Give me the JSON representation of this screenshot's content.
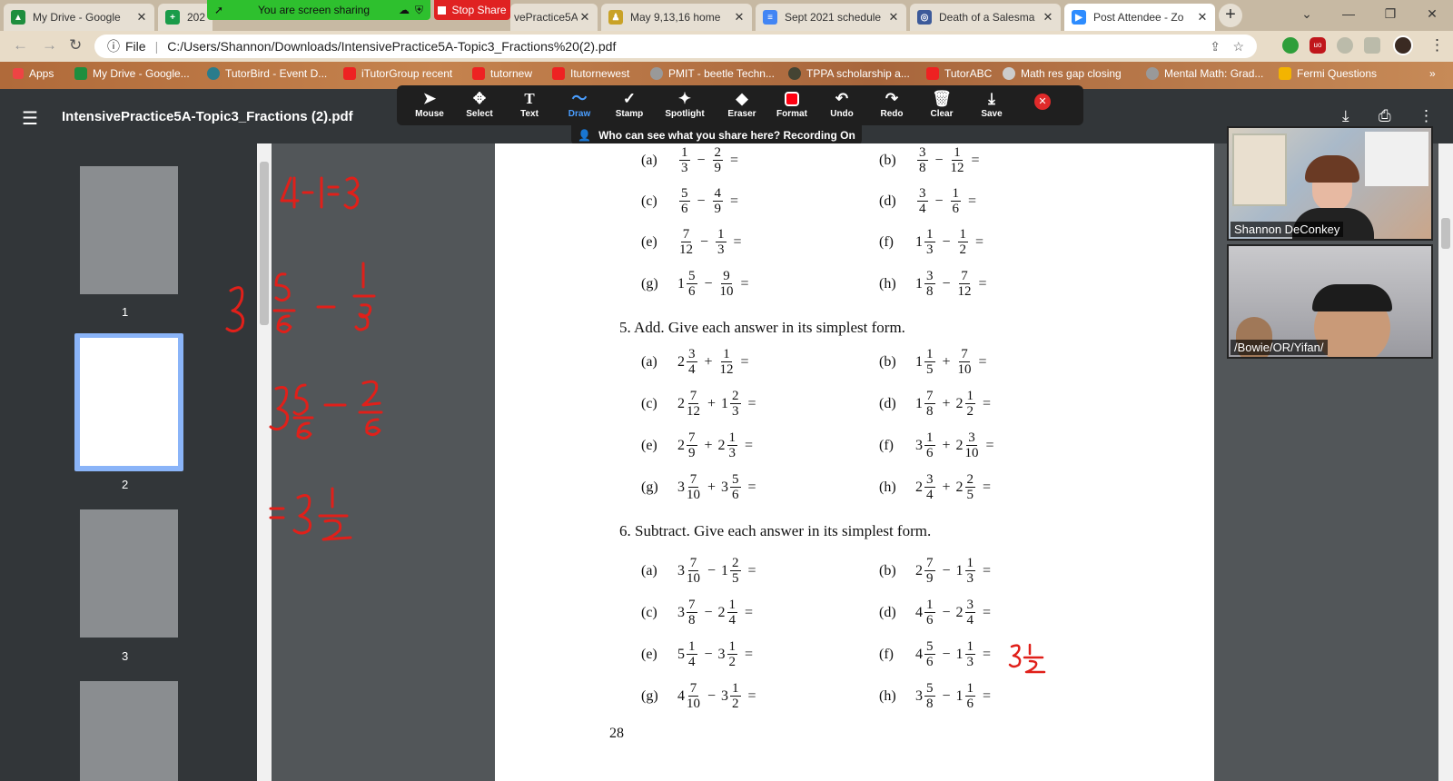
{
  "tabs": [
    {
      "title": "My Drive - Google",
      "color": "#1e8e3e",
      "glyph": "▲"
    },
    {
      "title": "202",
      "color": "#1a9c4a",
      "glyph": "+"
    },
    {
      "title": "vePractice5A",
      "color": "#666",
      "glyph": ""
    },
    {
      "title": "May 9,13,16 home",
      "color": "#c9a227",
      "glyph": "♟"
    },
    {
      "title": "Sept 2021 schedule",
      "color": "#4285f4",
      "glyph": "≡"
    },
    {
      "title": "Death of a Salesma",
      "color": "#3c5a9a",
      "glyph": "◎"
    },
    {
      "title": "Post Attendee - Zo",
      "color": "#2d8cff",
      "glyph": "▶"
    }
  ],
  "screen_share": {
    "message": "You are screen sharing",
    "stop_label": "Stop Share"
  },
  "address": {
    "prefix": "File",
    "url": "C:/Users/Shannon/Downloads/IntensivePractice5A-Topic3_Fractions%20(2).pdf"
  },
  "bookmarks": [
    "Apps",
    "My Drive - Google...",
    "TutorBird - Event D...",
    "iTutorGroup recent",
    "tutornew",
    "Itutornewest",
    "PMIT - beetle Techn...",
    "TPPA scholarship a...",
    "TutorABC",
    "Math res gap closing",
    "Mental Math: Grad...",
    "Fermi Questions"
  ],
  "pdf": {
    "title": "IntensivePractice5A-Topic3_Fractions (2).pdf",
    "page_number": "28"
  },
  "annotate_tools": [
    "Mouse",
    "Select",
    "Text",
    "Draw",
    "Stamp",
    "Spotlight",
    "Eraser",
    "Format",
    "Undo",
    "Redo",
    "Clear",
    "Save"
  ],
  "recording_notice": "Who can see what you share here? Recording On",
  "thumbnails": [
    "1",
    "2",
    "3"
  ],
  "sections": [
    {
      "heading": "5. Add. Give each answer in its simplest form."
    },
    {
      "heading": "6. Subtract. Give each answer in its simplest form."
    }
  ],
  "problem_labels": [
    "(a)",
    "(b)",
    "(c)",
    "(d)",
    "(e)",
    "(f)",
    "(g)",
    "(h)"
  ],
  "participants": [
    {
      "name": "Shannon DeConkey"
    },
    {
      "name": "/Bowie/OR/Yifan/"
    }
  ]
}
